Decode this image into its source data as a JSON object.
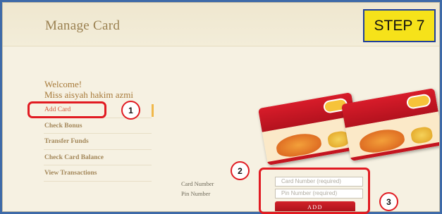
{
  "header": {
    "title": "Manage Card"
  },
  "step_badge": "STEP 7",
  "welcome": {
    "greeting": "Welcome!",
    "user_name": "Miss aisyah hakim azmi"
  },
  "sidebar": {
    "items": [
      {
        "label": "Add Card",
        "active": true
      },
      {
        "label": "Check Bonus"
      },
      {
        "label": "Transfer Funds"
      },
      {
        "label": "Check Card Balance"
      },
      {
        "label": "View Transactions"
      }
    ]
  },
  "form": {
    "card_number_label": "Card Number",
    "pin_number_label": "Pin Number",
    "card_number_placeholder": "Card Number (required)",
    "pin_number_placeholder": "Pin Number (required)",
    "add_button": "ADD"
  },
  "annotations": {
    "step1": "1",
    "step2": "2",
    "step3": "3"
  },
  "colors": {
    "accent_red": "#e11b22",
    "badge_yellow": "#f6e21a",
    "title_brown": "#9a8050"
  }
}
